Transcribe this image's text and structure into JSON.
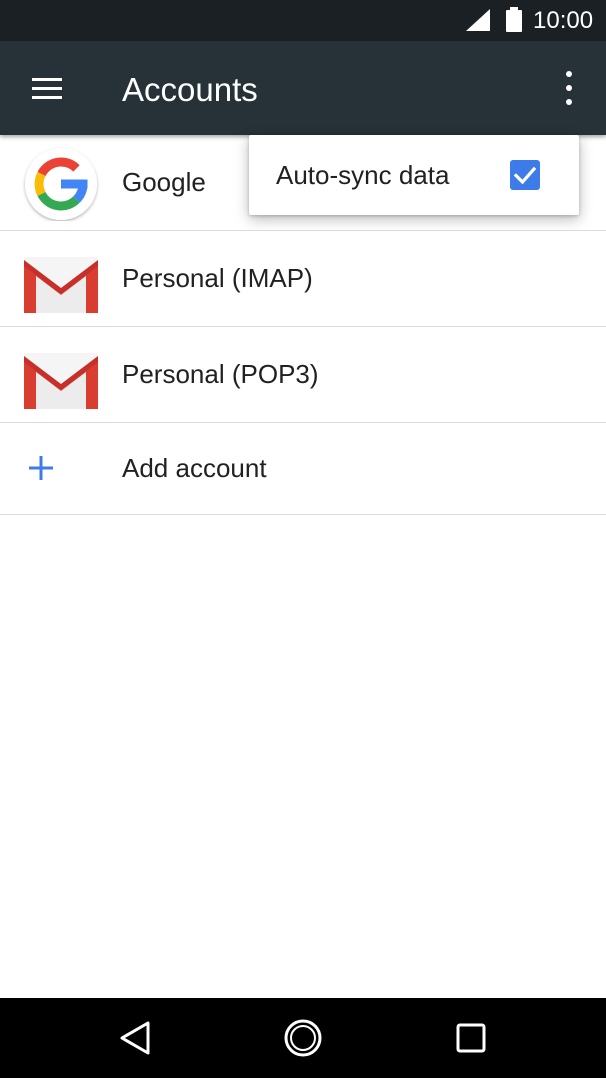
{
  "status_bar": {
    "time": "10:00",
    "icons": [
      "signal-icon",
      "battery-icon"
    ]
  },
  "toolbar": {
    "title": "Accounts",
    "menu_icon": "hamburger-menu-icon",
    "overflow_icon": "more-vert-icon"
  },
  "accounts": [
    {
      "label": "Google",
      "icon": "google-icon"
    },
    {
      "label": "Personal (IMAP)",
      "icon": "gmail-icon"
    },
    {
      "label": "Personal (POP3)",
      "icon": "gmail-icon"
    }
  ],
  "add_account": {
    "label": "Add account",
    "icon": "plus-icon"
  },
  "overflow_menu": {
    "items": [
      {
        "label": "Auto-sync data",
        "checked": true
      }
    ]
  },
  "nav_bar": {
    "icons": [
      "back-icon",
      "home-icon",
      "recents-icon"
    ]
  },
  "colors": {
    "toolbar": "#263238",
    "status_bar": "#1a2024",
    "accent": "#3d7be8",
    "gmail_red": "#d93d2f"
  }
}
